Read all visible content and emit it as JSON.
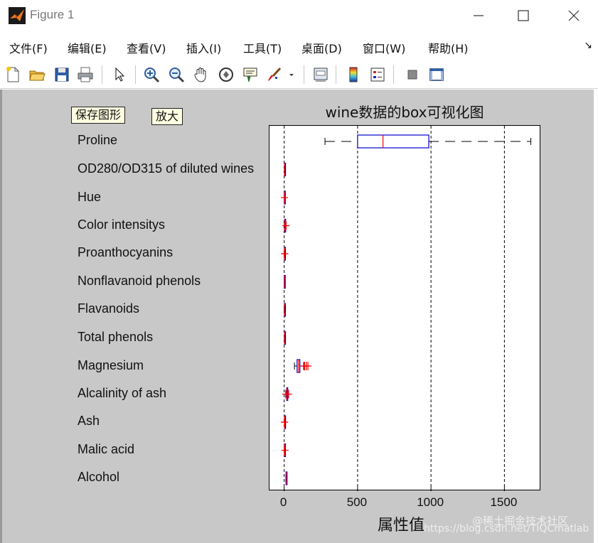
{
  "window": {
    "title": "Figure 1"
  },
  "menubar": {
    "items": [
      "文件(F)",
      "编辑(E)",
      "查看(V)",
      "插入(I)",
      "工具(T)",
      "桌面(D)",
      "窗口(W)",
      "帮助(H)"
    ],
    "corner_arrow": "↘"
  },
  "toolbar": {
    "icons": [
      "new-file-icon",
      "open-folder-icon",
      "save-icon",
      "print-icon",
      "pointer-icon",
      "zoom-in-icon",
      "zoom-out-icon",
      "pan-hand-icon",
      "rotate-3d-icon",
      "data-cursor-icon",
      "brush-icon",
      "link-plot-icon",
      "colorbar-icon",
      "legend-icon",
      "hide-plot-tools-icon",
      "show-plot-tools-icon"
    ]
  },
  "tooltips": {
    "save": "保存图形",
    "zoom": "放大"
  },
  "chart_data": {
    "type": "boxplot",
    "orientation": "horizontal",
    "title": "wine数据的box可视化图",
    "xlabel": "属性值",
    "xlim": [
      -100,
      1750
    ],
    "xticks": [
      0,
      500,
      1000,
      1500
    ],
    "grid": "x-dashed",
    "box_color": "#0000cc",
    "median_color": "#ff0000",
    "outlier_color": "#ff0000",
    "categories": [
      "Proline",
      "OD280/OD315 of diluted wines",
      "Hue",
      "Color intensitys",
      "Proanthocyanins",
      "Nonflavanoid phenols",
      "Flavanoids",
      "Total phenols",
      "Magnesium",
      "Alcalinity of ash",
      "Ash",
      "Malic acid",
      "Alcohol"
    ],
    "boxes": [
      {
        "name": "Proline",
        "whisker_low": 278,
        "q1": 500,
        "median": 673,
        "q3": 985,
        "whisker_high": 1680,
        "outliers": []
      },
      {
        "name": "OD280/OD315 of diluted wines",
        "whisker_low": 1.27,
        "q1": 1.94,
        "median": 2.78,
        "q3": 3.17,
        "whisker_high": 4.0,
        "outliers": []
      },
      {
        "name": "Hue",
        "whisker_low": 0.48,
        "q1": 0.78,
        "median": 0.96,
        "q3": 1.12,
        "whisker_high": 1.71,
        "outliers": [
          1.71
        ]
      },
      {
        "name": "Color intensitys",
        "whisker_low": 1.28,
        "q1": 3.2,
        "median": 4.7,
        "q3": 6.2,
        "whisker_high": 10.8,
        "outliers": [
          11.75,
          13.0
        ]
      },
      {
        "name": "Proanthocyanins",
        "whisker_low": 0.41,
        "q1": 1.25,
        "median": 1.56,
        "q3": 1.95,
        "whisker_high": 2.96,
        "outliers": [
          3.28,
          3.58
        ]
      },
      {
        "name": "Nonflavanoid phenols",
        "whisker_low": 0.13,
        "q1": 0.27,
        "median": 0.34,
        "q3": 0.44,
        "whisker_high": 0.66,
        "outliers": []
      },
      {
        "name": "Flavanoids",
        "whisker_low": 0.34,
        "q1": 1.2,
        "median": 2.13,
        "q3": 2.88,
        "whisker_high": 5.08,
        "outliers": []
      },
      {
        "name": "Total phenols",
        "whisker_low": 0.98,
        "q1": 1.74,
        "median": 2.35,
        "q3": 2.8,
        "whisker_high": 3.88,
        "outliers": []
      },
      {
        "name": "Magnesium",
        "whisker_low": 70,
        "q1": 88,
        "median": 98,
        "q3": 107,
        "whisker_high": 132,
        "outliers": [
          134,
          139,
          151,
          162
        ]
      },
      {
        "name": "Alcalinity of ash",
        "whisker_low": 10.6,
        "q1": 17.2,
        "median": 19.5,
        "q3": 21.5,
        "whisker_high": 28.5,
        "outliers": [
          10.6,
          30
        ]
      },
      {
        "name": "Ash",
        "whisker_low": 1.7,
        "q1": 2.21,
        "median": 2.36,
        "q3": 2.56,
        "whisker_high": 3.07,
        "outliers": [
          1.36,
          3.22
        ]
      },
      {
        "name": "Malic acid",
        "whisker_low": 0.74,
        "q1": 1.6,
        "median": 1.87,
        "q3": 3.08,
        "whisker_high": 5.8,
        "outliers": [
          5.8
        ]
      },
      {
        "name": "Alcohol",
        "whisker_low": 11.03,
        "q1": 12.36,
        "median": 13.05,
        "q3": 13.68,
        "whisker_high": 14.83,
        "outliers": []
      }
    ]
  },
  "watermarks": [
    "@稀土掘金技术社区",
    "https://blog.csdn.net/TIQCmatlab"
  ]
}
